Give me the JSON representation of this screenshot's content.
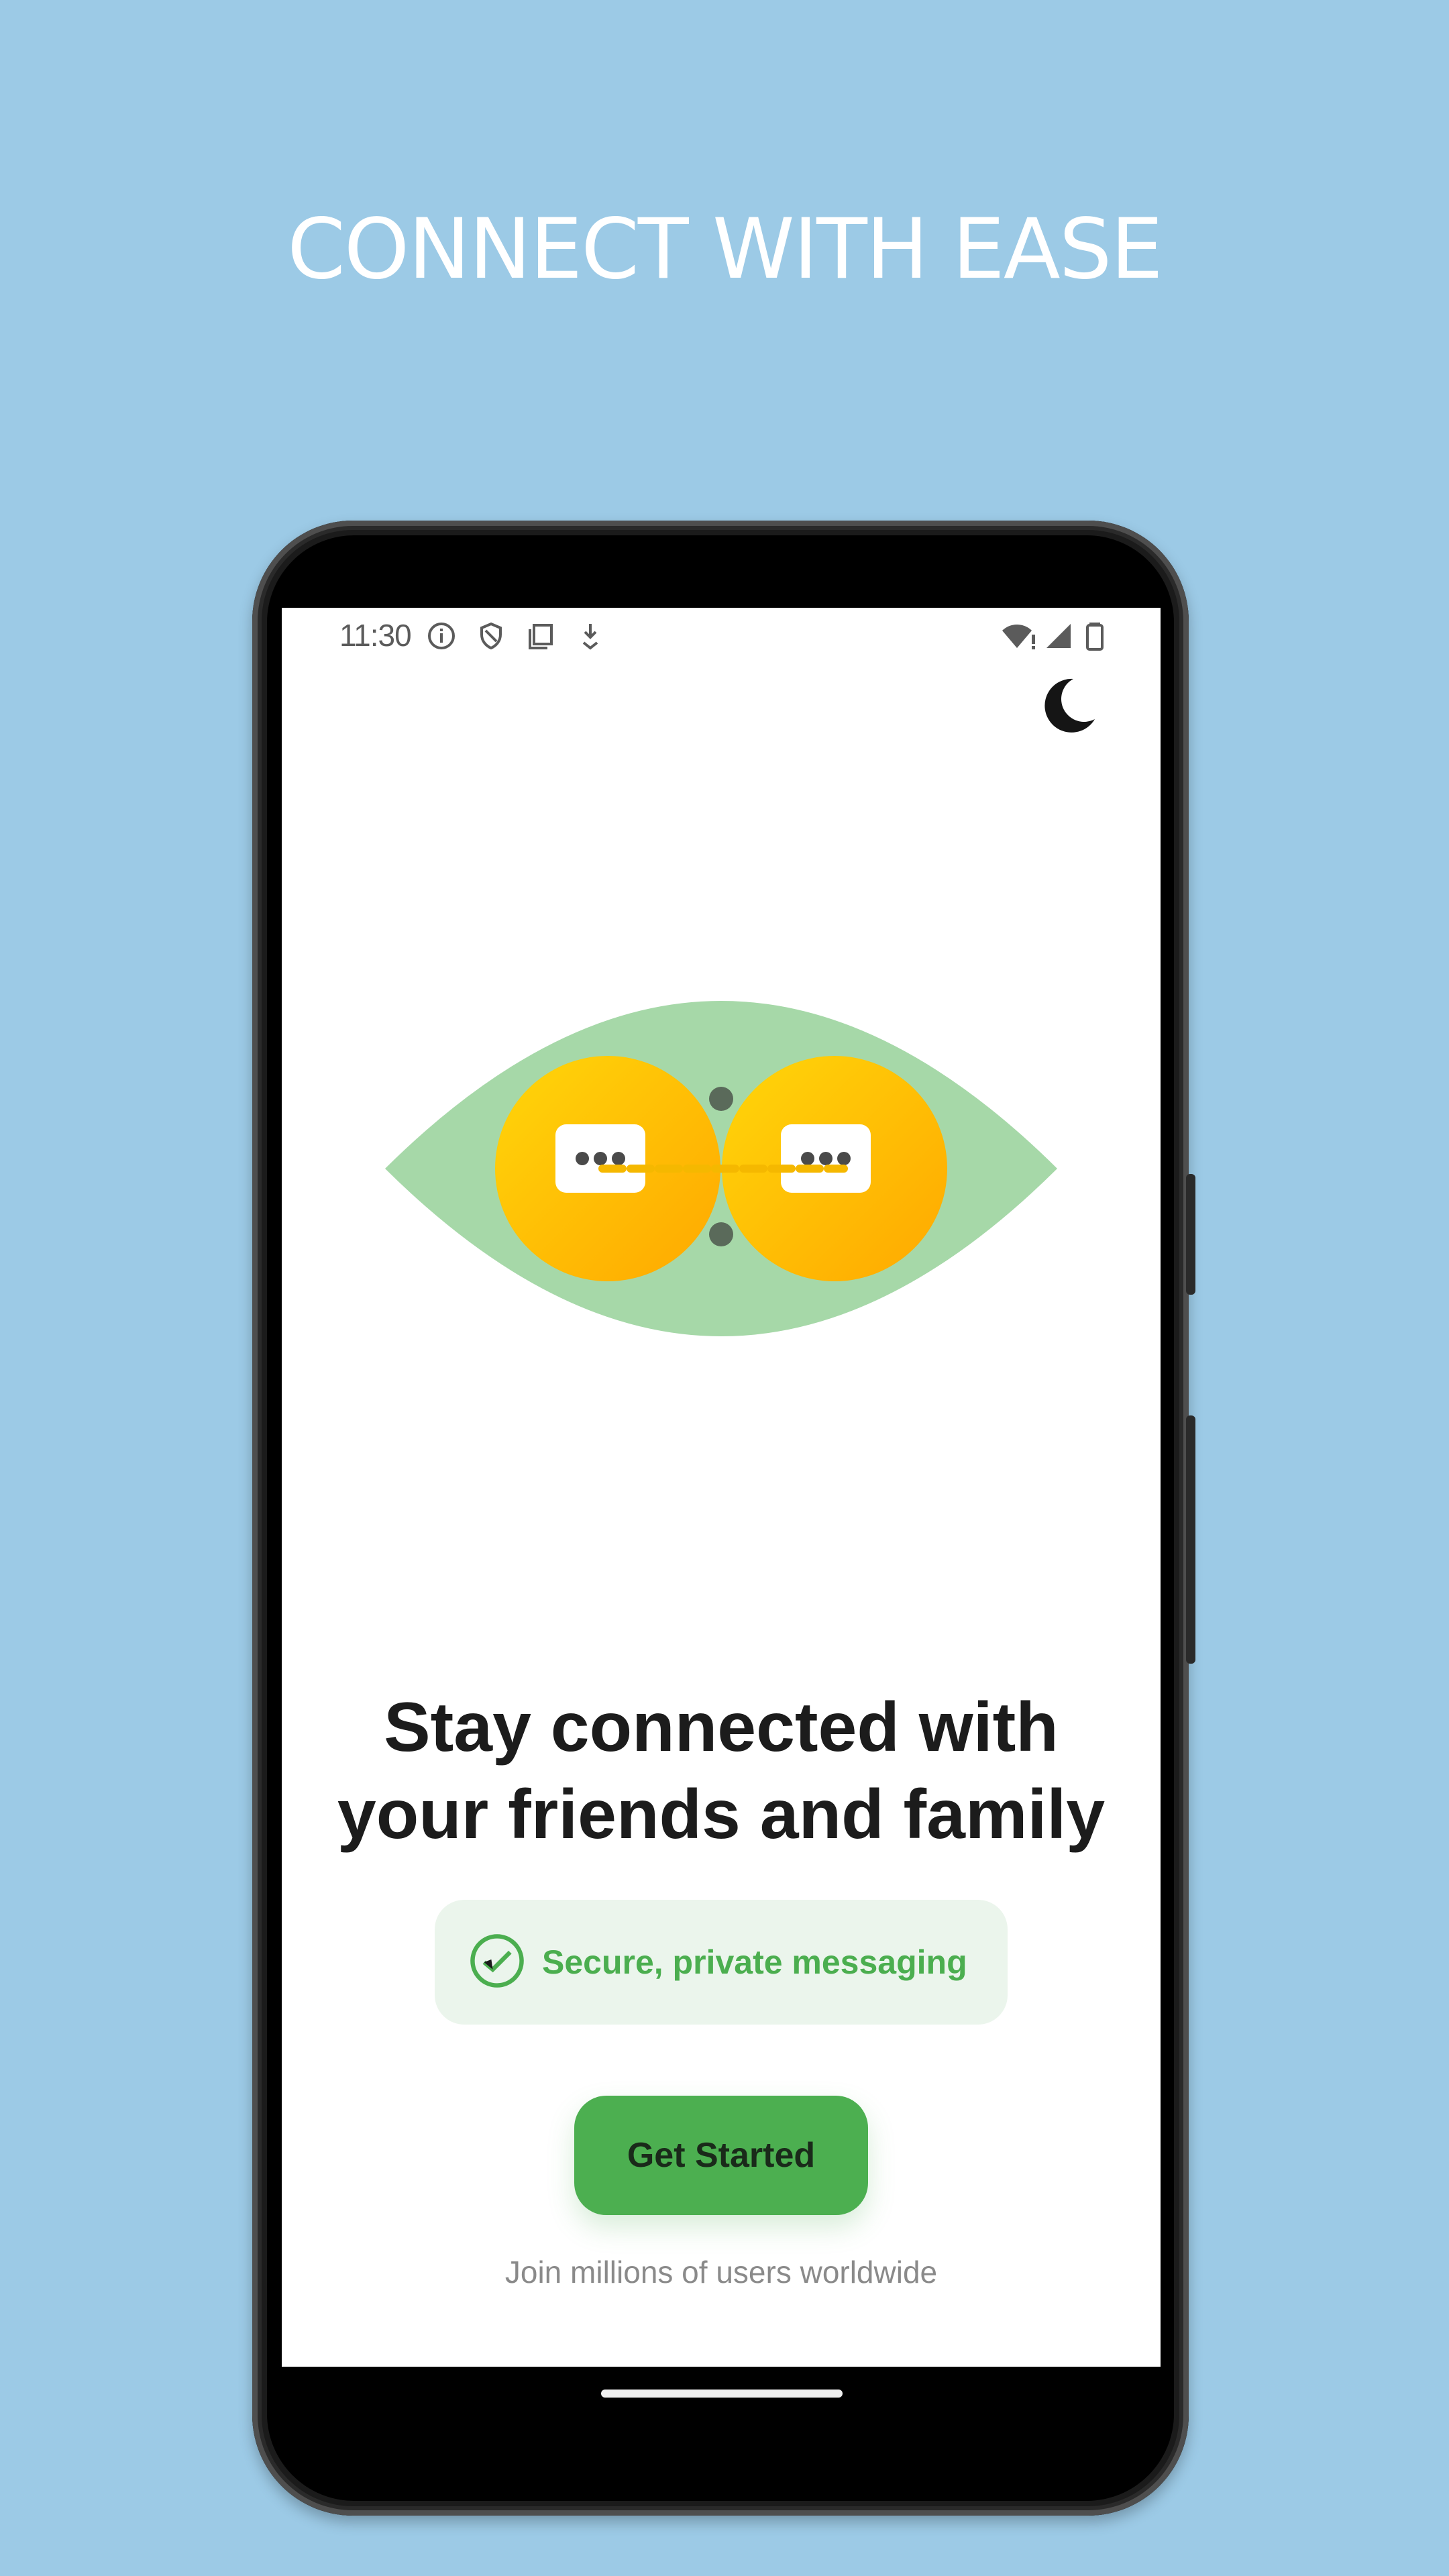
{
  "promo": {
    "headline": "CONNECT WITH EASE"
  },
  "status_bar": {
    "time": "11:30",
    "left_icons": [
      "info-icon",
      "shield-icon",
      "sim-card-icon",
      "download-icon"
    ],
    "right_icons": [
      "wifi-alert-icon",
      "cell-signal-icon",
      "battery-icon"
    ]
  },
  "toolbar": {
    "theme_toggle_icon": "moon-icon"
  },
  "hero": {
    "illustration": "two-chat-bubbles-in-leaf"
  },
  "onboarding": {
    "title_line1": "Stay connected with",
    "title_line2": "your friends and family",
    "badge_text": "Secure, private messaging",
    "cta_label": "Get Started",
    "subtext": "Join millions of users worldwide"
  },
  "colors": {
    "background": "#9ccae6",
    "accent_green": "#4caf50",
    "badge_bg": "#ebf5ec",
    "leaf": "#a6d8a8",
    "bubble_yellow": "#ffc21a"
  }
}
